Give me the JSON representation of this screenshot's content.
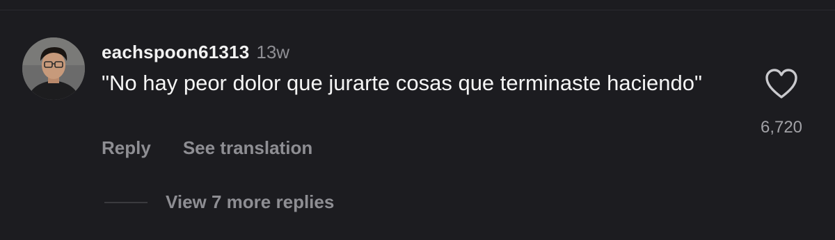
{
  "comment": {
    "username": "eachspoon61313",
    "timestamp": "13w",
    "text": "\"No hay peor dolor que jurarte cosas que terminaste haciendo\"",
    "like_icon": "heart-outline-icon",
    "like_count": "6,720",
    "actions": {
      "reply_label": "Reply",
      "translate_label": "See translation"
    },
    "view_replies_label": "View 7 more replies"
  },
  "colors": {
    "background": "#1c1c20",
    "primary_text": "#f5f5f5",
    "secondary_text": "#8e8e93"
  }
}
